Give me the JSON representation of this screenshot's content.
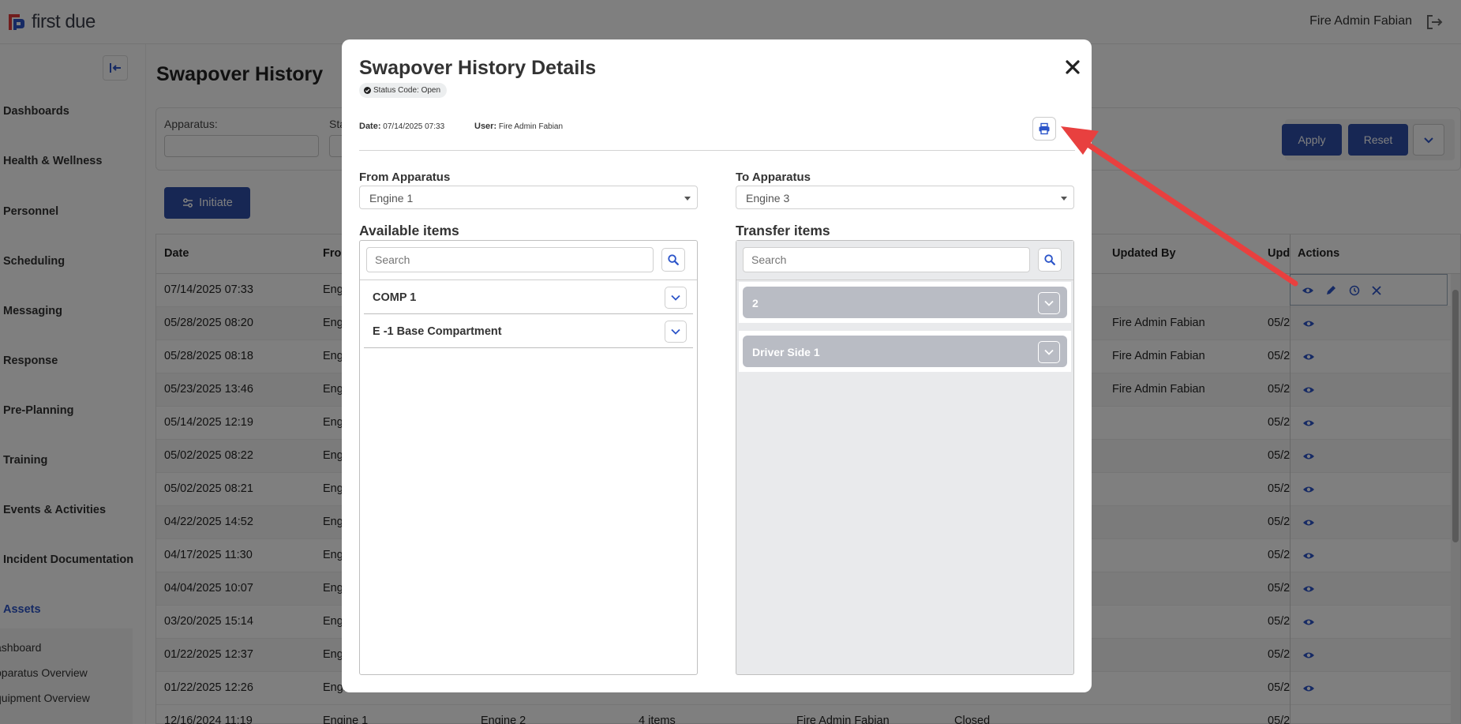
{
  "app": {
    "brand": "first due",
    "user_name": "Fire Admin Fabian"
  },
  "sidebar": {
    "items": [
      {
        "label": "Dashboards"
      },
      {
        "label": "Health & Wellness"
      },
      {
        "label": "Personnel"
      },
      {
        "label": "Scheduling"
      },
      {
        "label": "Messaging"
      },
      {
        "label": "Response"
      },
      {
        "label": "Pre-Planning"
      },
      {
        "label": "Training"
      },
      {
        "label": "Events & Activities"
      },
      {
        "label": "Incident Documentation"
      },
      {
        "label": "Assets"
      }
    ],
    "subitems": [
      {
        "label": "ashboard"
      },
      {
        "label": "pparatus Overview"
      },
      {
        "label": "quipment Overview"
      }
    ]
  },
  "page": {
    "title": "Swapover History",
    "filter_apparatus_label": "Apparatus:",
    "filter_status_label": "Sta",
    "apply_label": "Apply",
    "reset_label": "Reset",
    "initiate_label": "Initiate"
  },
  "grid": {
    "headers": {
      "date": "Date",
      "from": "Fro",
      "updated_by": "Updated By",
      "updated_at": "Upd",
      "actions": "Actions"
    },
    "rows": [
      {
        "date": "07/14/2025 07:33",
        "from": "Engi",
        "updated_by": "",
        "updated_at": ""
      },
      {
        "date": "05/28/2025 08:20",
        "from": "Engi",
        "updated_by": "Fire Admin Fabian",
        "updated_at": "05/2"
      },
      {
        "date": "05/28/2025 08:18",
        "from": "Engi",
        "updated_by": "Fire Admin Fabian",
        "updated_at": "05/2"
      },
      {
        "date": "05/23/2025 13:46",
        "from": "Engi",
        "updated_by": "Fire Admin Fabian",
        "updated_at": "05/2"
      },
      {
        "date": "05/14/2025 12:19",
        "from": "Engi",
        "updated_by": "",
        "updated_at": "05/2"
      },
      {
        "date": "05/02/2025 08:22",
        "from": "Engi",
        "updated_by": "",
        "updated_at": "05/2"
      },
      {
        "date": "05/02/2025 08:21",
        "from": "Engi",
        "updated_by": "",
        "updated_at": "05/2"
      },
      {
        "date": "04/22/2025 14:52",
        "from": "Engi",
        "updated_by": "",
        "updated_at": "05/2"
      },
      {
        "date": "04/17/2025 11:30",
        "from": "Engi",
        "updated_by": "",
        "updated_at": "05/2"
      },
      {
        "date": "04/04/2025 10:07",
        "from": "Engi",
        "updated_by": "",
        "updated_at": "05/2"
      },
      {
        "date": "03/20/2025 15:14",
        "from": "Engi",
        "updated_by": "",
        "updated_at": "05/2"
      },
      {
        "date": "01/22/2025 12:37",
        "from": "Engi",
        "updated_by": "",
        "updated_at": "05/2"
      },
      {
        "date": "01/22/2025 12:26",
        "from": "Engi",
        "updated_by": "",
        "updated_at": "05/2"
      }
    ],
    "last_row": {
      "date": "12/16/2024 11:19",
      "from": "Engine 1",
      "to": "Engine 2",
      "items": "4 items",
      "by": "Fire Admin Fabian",
      "status": "Closed",
      "updated_at": "05/2"
    }
  },
  "modal": {
    "title": "Swapover History Details",
    "status_chip": "Status Code: Open",
    "date_label": "Date:",
    "date_value": "07/14/2025 07:33",
    "user_label": "User:",
    "user_value": "Fire Admin Fabian",
    "from_label": "From Apparatus",
    "from_value": "Engine 1",
    "to_label": "To Apparatus",
    "to_value": "Engine 3",
    "available_heading": "Available items",
    "transfer_heading": "Transfer items",
    "search_placeholder": "Search",
    "available_items": [
      {
        "label": "COMP 1"
      },
      {
        "label": "E -1 Base Compartment"
      }
    ],
    "transfer_items": [
      {
        "label": "2"
      },
      {
        "label": "Driver Side 1"
      }
    ]
  },
  "icons": {
    "close": "close-icon",
    "print": "printer-icon",
    "search": "search-icon",
    "expand": "chevron-down-icon",
    "status": "check-circle-icon"
  },
  "colors": {
    "primary": "#2f4fa9",
    "link_blue": "#2c55c9",
    "annotation_arrow": "#e8403f",
    "transfer_bar": "#b9bcc4"
  }
}
